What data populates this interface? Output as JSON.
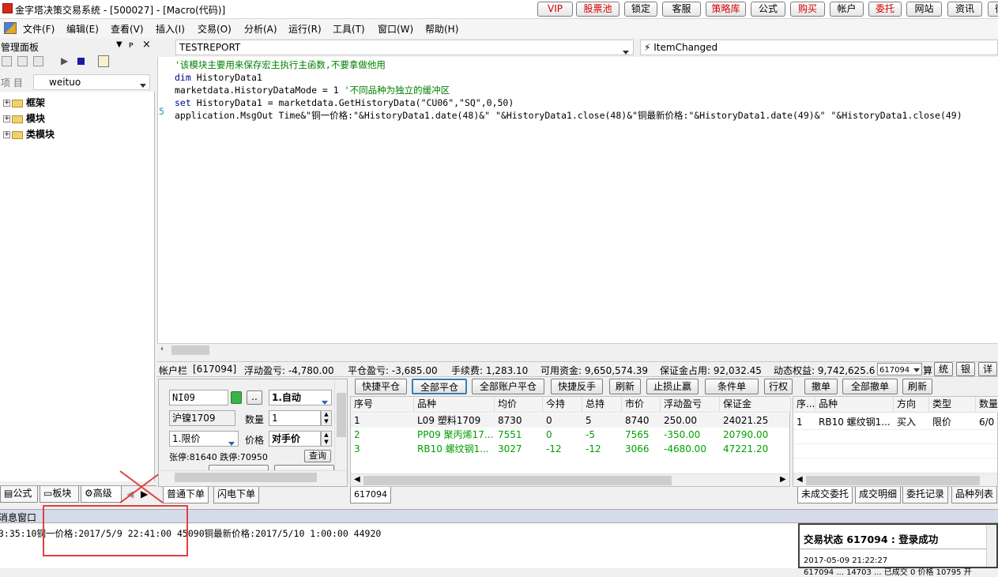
{
  "window": {
    "title": "金字塔决策交易系统 - [500027] - [Macro(代码)]"
  },
  "toolbar_buttons": [
    {
      "label": "VIP",
      "red": true
    },
    {
      "label": "股票池",
      "red": true
    },
    {
      "label": "锁定",
      "red": false
    },
    {
      "label": "客服",
      "red": false
    },
    {
      "label": "策略库",
      "red": true
    },
    {
      "label": "公式",
      "red": false
    },
    {
      "label": "购买",
      "red": true
    },
    {
      "label": "帐户",
      "red": false
    },
    {
      "label": "委托",
      "red": true
    },
    {
      "label": "网站",
      "red": false
    },
    {
      "label": "资讯",
      "red": false
    },
    {
      "label": "後",
      "red": false
    }
  ],
  "menu": [
    "文件(F)",
    "编辑(E)",
    "查看(V)",
    "插入(I)",
    "交易(O)",
    "分析(A)",
    "运行(R)",
    "工具(T)",
    "窗口(W)",
    "帮助(H)"
  ],
  "left_panel": {
    "title": "管理面板",
    "project_label": "项 目",
    "project_value": "weituo",
    "tree": [
      "框架",
      "模块",
      "类模块"
    ],
    "bottom_tabs": [
      "公式",
      "板块",
      "高级"
    ]
  },
  "editor": {
    "module_combo": "TESTREPORT",
    "event_combo": "ItemChanged",
    "lines": [
      {
        "kw": "",
        "text": "'该模块主要用来保存宏主执行主函数,不要拿做他用",
        "comment": ""
      },
      {
        "kw": "dim",
        "text": " HistoryData1",
        "comment": ""
      },
      {
        "kw": "",
        "text": "marketdata.HistoryDataMode = 1 ",
        "comment": "'不同品种为独立的缓冲区"
      },
      {
        "kw": "set",
        "text": " HistoryData1 = marketdata.GetHistoryData(\"CU06\",\"SQ\",0,50)",
        "comment": ""
      },
      {
        "kw": "",
        "text": "application.MsgOut Time&\"铜一价格:\"&HistoryData1.date(48)&\"  \"&HistoryData1.close(48)&\"铜最新价格:\"&HistoryData1.date(49)&\"  \"&HistoryData1.close(49)",
        "comment": ""
      }
    ],
    "line_number": "5"
  },
  "account_bar": {
    "label": "帐户栏",
    "account": "[617094]",
    "float_pnl": "浮动盈亏: -4,780.00",
    "close_pnl": "平仓盈亏: -3,685.00",
    "fee": "手续费: 1,283.10",
    "available": "可用资金: 9,650,574.39",
    "margin": "保证金占用: 92,032.45",
    "equity": "动态权益: 9,742,625.6",
    "account_select": "617094",
    "btn1": "统",
    "btn2": "银",
    "btn3": "详",
    "extra": "算"
  },
  "order_panel": {
    "symbol": "NI09",
    "mode": "1.自动",
    "name": "沪镍1709",
    "qty_label": "数量",
    "qty": "1",
    "price_type": "1.限价",
    "price_label": "价格",
    "price_value": "对手价",
    "limit_text": "张停:81640 跌停:70950",
    "query_btn": "查询",
    "dots_btn": "..",
    "tabs": [
      "普通下单",
      "闪电下单"
    ]
  },
  "position_buttons": [
    "快捷平仓",
    "全部平仓",
    "全部账户平仓",
    "快捷反手",
    "刷新",
    "止损止赢",
    "条件单",
    "行权"
  ],
  "positions": {
    "columns": [
      "序号",
      "品种",
      "均价",
      "今持",
      "总持",
      "市价",
      "浮动盈亏",
      "保证金"
    ],
    "rows": [
      {
        "cells": [
          "1",
          "L09 塑料1709",
          "8730",
          "0",
          "5",
          "8740",
          "250.00",
          "24021.25"
        ],
        "color": "#000000"
      },
      {
        "cells": [
          "2",
          "PP09 聚丙烯17...",
          "7551",
          "0",
          "-5",
          "7565",
          "-350.00",
          "20790.00"
        ],
        "color": "#00a000"
      },
      {
        "cells": [
          "3",
          "RB10 螺纹钢1...",
          "3027",
          "-12",
          "-12",
          "3066",
          "-4680.00",
          "47221.20"
        ],
        "color": "#00a000"
      }
    ],
    "footer_tab": "617094"
  },
  "order_buttons": [
    "撤单",
    "全部撤单",
    "刷新"
  ],
  "orders": {
    "columns": [
      "序...",
      "品种",
      "方向",
      "类型",
      "数量"
    ],
    "rows": [
      {
        "cells": [
          "1",
          "RB10 螺纹钢1...",
          "买入",
          "限价",
          "6/0"
        ]
      }
    ],
    "tabs": [
      "未成交委托",
      "成交明细",
      "委托记录",
      "品种列表"
    ]
  },
  "message_window": {
    "title": "消息窗口",
    "line": "3:35:10铜一价格:2017/5/9 22:41:00  45090铜最新价格:2017/5/10 1:00:00  44920"
  },
  "trade_status": {
    "title": "交易状态 617094 : 登录成功",
    "time": "2017-05-09 21:22:27",
    "detail": "617094 ... 14703 ... 已成交 0 价格 10795 开"
  },
  "colors": {
    "annotation_red": "#e04040",
    "buy_green": "#00a000",
    "code_comment": "#008000",
    "code_keyword": "#000090"
  }
}
